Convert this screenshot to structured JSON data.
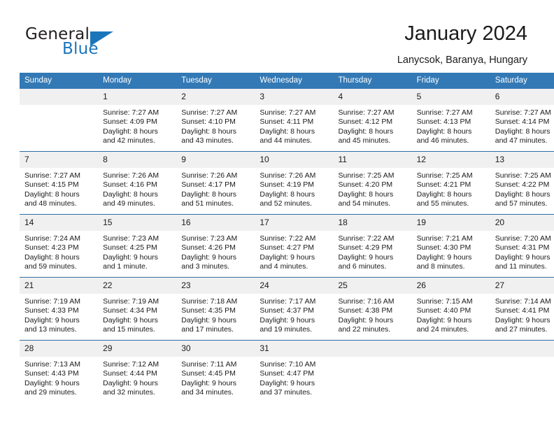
{
  "brand": {
    "name_part1": "General",
    "name_part2": "Blue",
    "accent_color": "#1b75bb"
  },
  "header": {
    "title": "January 2024",
    "location": "Lanycsok, Baranya, Hungary"
  },
  "theme": {
    "header_bg": "#3379b5",
    "row_divider": "#2e6da4",
    "daynum_bg": "#f0f0f0"
  },
  "weekdays": [
    "Sunday",
    "Monday",
    "Tuesday",
    "Wednesday",
    "Thursday",
    "Friday",
    "Saturday"
  ],
  "weeks": [
    [
      {
        "day": "",
        "sunrise": "",
        "sunset": "",
        "daylight1": "",
        "daylight2": ""
      },
      {
        "day": "1",
        "sunrise": "Sunrise: 7:27 AM",
        "sunset": "Sunset: 4:09 PM",
        "daylight1": "Daylight: 8 hours",
        "daylight2": "and 42 minutes."
      },
      {
        "day": "2",
        "sunrise": "Sunrise: 7:27 AM",
        "sunset": "Sunset: 4:10 PM",
        "daylight1": "Daylight: 8 hours",
        "daylight2": "and 43 minutes."
      },
      {
        "day": "3",
        "sunrise": "Sunrise: 7:27 AM",
        "sunset": "Sunset: 4:11 PM",
        "daylight1": "Daylight: 8 hours",
        "daylight2": "and 44 minutes."
      },
      {
        "day": "4",
        "sunrise": "Sunrise: 7:27 AM",
        "sunset": "Sunset: 4:12 PM",
        "daylight1": "Daylight: 8 hours",
        "daylight2": "and 45 minutes."
      },
      {
        "day": "5",
        "sunrise": "Sunrise: 7:27 AM",
        "sunset": "Sunset: 4:13 PM",
        "daylight1": "Daylight: 8 hours",
        "daylight2": "and 46 minutes."
      },
      {
        "day": "6",
        "sunrise": "Sunrise: 7:27 AM",
        "sunset": "Sunset: 4:14 PM",
        "daylight1": "Daylight: 8 hours",
        "daylight2": "and 47 minutes."
      }
    ],
    [
      {
        "day": "7",
        "sunrise": "Sunrise: 7:27 AM",
        "sunset": "Sunset: 4:15 PM",
        "daylight1": "Daylight: 8 hours",
        "daylight2": "and 48 minutes."
      },
      {
        "day": "8",
        "sunrise": "Sunrise: 7:26 AM",
        "sunset": "Sunset: 4:16 PM",
        "daylight1": "Daylight: 8 hours",
        "daylight2": "and 49 minutes."
      },
      {
        "day": "9",
        "sunrise": "Sunrise: 7:26 AM",
        "sunset": "Sunset: 4:17 PM",
        "daylight1": "Daylight: 8 hours",
        "daylight2": "and 51 minutes."
      },
      {
        "day": "10",
        "sunrise": "Sunrise: 7:26 AM",
        "sunset": "Sunset: 4:19 PM",
        "daylight1": "Daylight: 8 hours",
        "daylight2": "and 52 minutes."
      },
      {
        "day": "11",
        "sunrise": "Sunrise: 7:25 AM",
        "sunset": "Sunset: 4:20 PM",
        "daylight1": "Daylight: 8 hours",
        "daylight2": "and 54 minutes."
      },
      {
        "day": "12",
        "sunrise": "Sunrise: 7:25 AM",
        "sunset": "Sunset: 4:21 PM",
        "daylight1": "Daylight: 8 hours",
        "daylight2": "and 55 minutes."
      },
      {
        "day": "13",
        "sunrise": "Sunrise: 7:25 AM",
        "sunset": "Sunset: 4:22 PM",
        "daylight1": "Daylight: 8 hours",
        "daylight2": "and 57 minutes."
      }
    ],
    [
      {
        "day": "14",
        "sunrise": "Sunrise: 7:24 AM",
        "sunset": "Sunset: 4:23 PM",
        "daylight1": "Daylight: 8 hours",
        "daylight2": "and 59 minutes."
      },
      {
        "day": "15",
        "sunrise": "Sunrise: 7:23 AM",
        "sunset": "Sunset: 4:25 PM",
        "daylight1": "Daylight: 9 hours",
        "daylight2": "and 1 minute."
      },
      {
        "day": "16",
        "sunrise": "Sunrise: 7:23 AM",
        "sunset": "Sunset: 4:26 PM",
        "daylight1": "Daylight: 9 hours",
        "daylight2": "and 3 minutes."
      },
      {
        "day": "17",
        "sunrise": "Sunrise: 7:22 AM",
        "sunset": "Sunset: 4:27 PM",
        "daylight1": "Daylight: 9 hours",
        "daylight2": "and 4 minutes."
      },
      {
        "day": "18",
        "sunrise": "Sunrise: 7:22 AM",
        "sunset": "Sunset: 4:29 PM",
        "daylight1": "Daylight: 9 hours",
        "daylight2": "and 6 minutes."
      },
      {
        "day": "19",
        "sunrise": "Sunrise: 7:21 AM",
        "sunset": "Sunset: 4:30 PM",
        "daylight1": "Daylight: 9 hours",
        "daylight2": "and 8 minutes."
      },
      {
        "day": "20",
        "sunrise": "Sunrise: 7:20 AM",
        "sunset": "Sunset: 4:31 PM",
        "daylight1": "Daylight: 9 hours",
        "daylight2": "and 11 minutes."
      }
    ],
    [
      {
        "day": "21",
        "sunrise": "Sunrise: 7:19 AM",
        "sunset": "Sunset: 4:33 PM",
        "daylight1": "Daylight: 9 hours",
        "daylight2": "and 13 minutes."
      },
      {
        "day": "22",
        "sunrise": "Sunrise: 7:19 AM",
        "sunset": "Sunset: 4:34 PM",
        "daylight1": "Daylight: 9 hours",
        "daylight2": "and 15 minutes."
      },
      {
        "day": "23",
        "sunrise": "Sunrise: 7:18 AM",
        "sunset": "Sunset: 4:35 PM",
        "daylight1": "Daylight: 9 hours",
        "daylight2": "and 17 minutes."
      },
      {
        "day": "24",
        "sunrise": "Sunrise: 7:17 AM",
        "sunset": "Sunset: 4:37 PM",
        "daylight1": "Daylight: 9 hours",
        "daylight2": "and 19 minutes."
      },
      {
        "day": "25",
        "sunrise": "Sunrise: 7:16 AM",
        "sunset": "Sunset: 4:38 PM",
        "daylight1": "Daylight: 9 hours",
        "daylight2": "and 22 minutes."
      },
      {
        "day": "26",
        "sunrise": "Sunrise: 7:15 AM",
        "sunset": "Sunset: 4:40 PM",
        "daylight1": "Daylight: 9 hours",
        "daylight2": "and 24 minutes."
      },
      {
        "day": "27",
        "sunrise": "Sunrise: 7:14 AM",
        "sunset": "Sunset: 4:41 PM",
        "daylight1": "Daylight: 9 hours",
        "daylight2": "and 27 minutes."
      }
    ],
    [
      {
        "day": "28",
        "sunrise": "Sunrise: 7:13 AM",
        "sunset": "Sunset: 4:43 PM",
        "daylight1": "Daylight: 9 hours",
        "daylight2": "and 29 minutes."
      },
      {
        "day": "29",
        "sunrise": "Sunrise: 7:12 AM",
        "sunset": "Sunset: 4:44 PM",
        "daylight1": "Daylight: 9 hours",
        "daylight2": "and 32 minutes."
      },
      {
        "day": "30",
        "sunrise": "Sunrise: 7:11 AM",
        "sunset": "Sunset: 4:45 PM",
        "daylight1": "Daylight: 9 hours",
        "daylight2": "and 34 minutes."
      },
      {
        "day": "31",
        "sunrise": "Sunrise: 7:10 AM",
        "sunset": "Sunset: 4:47 PM",
        "daylight1": "Daylight: 9 hours",
        "daylight2": "and 37 minutes."
      },
      {
        "day": "",
        "sunrise": "",
        "sunset": "",
        "daylight1": "",
        "daylight2": ""
      },
      {
        "day": "",
        "sunrise": "",
        "sunset": "",
        "daylight1": "",
        "daylight2": ""
      },
      {
        "day": "",
        "sunrise": "",
        "sunset": "",
        "daylight1": "",
        "daylight2": ""
      }
    ]
  ]
}
